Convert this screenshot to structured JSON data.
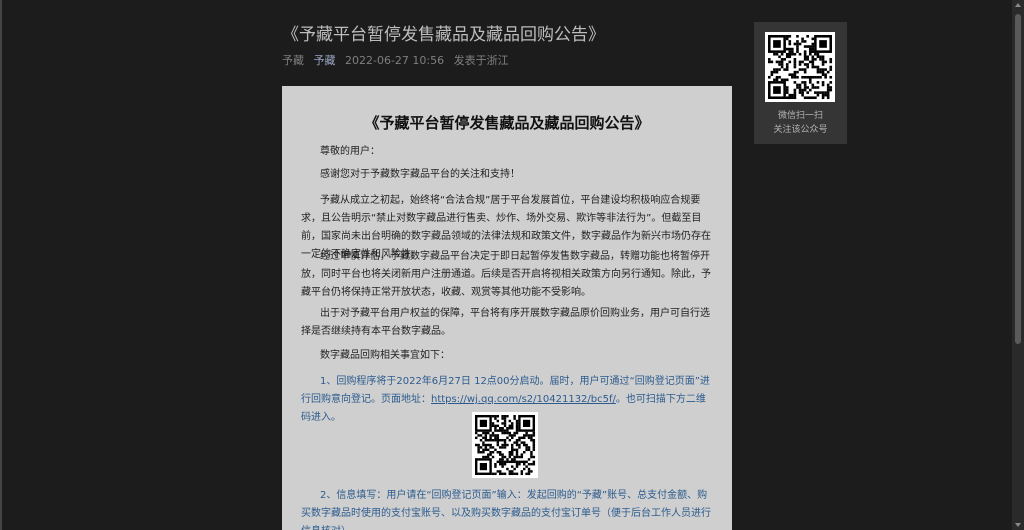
{
  "page": {
    "title": "《予藏平台暂停发售藏品及藏品回购公告》",
    "meta": {
      "author": "予藏",
      "account": "予藏",
      "datetime": "2022-06-27 10:56",
      "location": "发表于浙江"
    }
  },
  "sidecard": {
    "caption_line1": "微信扫一扫",
    "caption_line2": "关注该公众号"
  },
  "article": {
    "heading": "《予藏平台暂停发售藏品及藏品回购公告》",
    "greeting": "尊敬的用户：",
    "thanks": "感谢您对于予藏数字藏品平台的关注和支持！",
    "para1": "予藏从成立之初起，始终将“合法合规”居于平台发展首位，平台建设均积极响应合规要求，且公告明示“禁止对数字藏品进行售卖、炒作、场外交易、欺诈等非法行为”。但截至目前，国家尚未出台明确的数字藏品领域的法律法规和政策文件，数字藏品作为新兴市场仍存在一定的不确定性和风险性。",
    "para2": "经过审慎评估，予藏数字藏品平台决定于即日起暂停发售数字藏品，转赠功能也将暂停开放，同时平台也将关闭新用户注册通道。后续是否开启将视相关政策方向另行通知。除此，予藏平台仍将保持正常开放状态，收藏、观赏等其他功能不受影响。",
    "para3": "出于对予藏平台用户权益的保障，平台将有序开展数字藏品原价回购业务，用户可自行选择是否继续持有本平台数字藏品。",
    "para4": "数字藏品回购相关事宜如下：",
    "item1_prefix": "1、回购程序将于2022年6月27日 12点00分启动。届时，用户可通过“回购登记页面”进行回购意向登记。页面地址：",
    "item1_url": "https://wj.qq.com/s2/10421132/bc5f/",
    "item1_suffix": "。也可扫描下方二维码进入。",
    "item2": "2、信息填写：用户请在“回购登记页面”输入：发起回购的“予藏”账号、总支付金额、购买数字藏品时使用的支付宝账号、以及购买数字藏品的支付宝订单号（便于后台工作人员进行信息核对）。"
  },
  "colors": {
    "background": "#1c1c1c",
    "article_bg": "#cfcfcf",
    "link_blue": "#2c5b8e"
  },
  "icons": {
    "sidebar_qr": "qr-code-icon",
    "inline_qr": "qr-code-icon"
  }
}
